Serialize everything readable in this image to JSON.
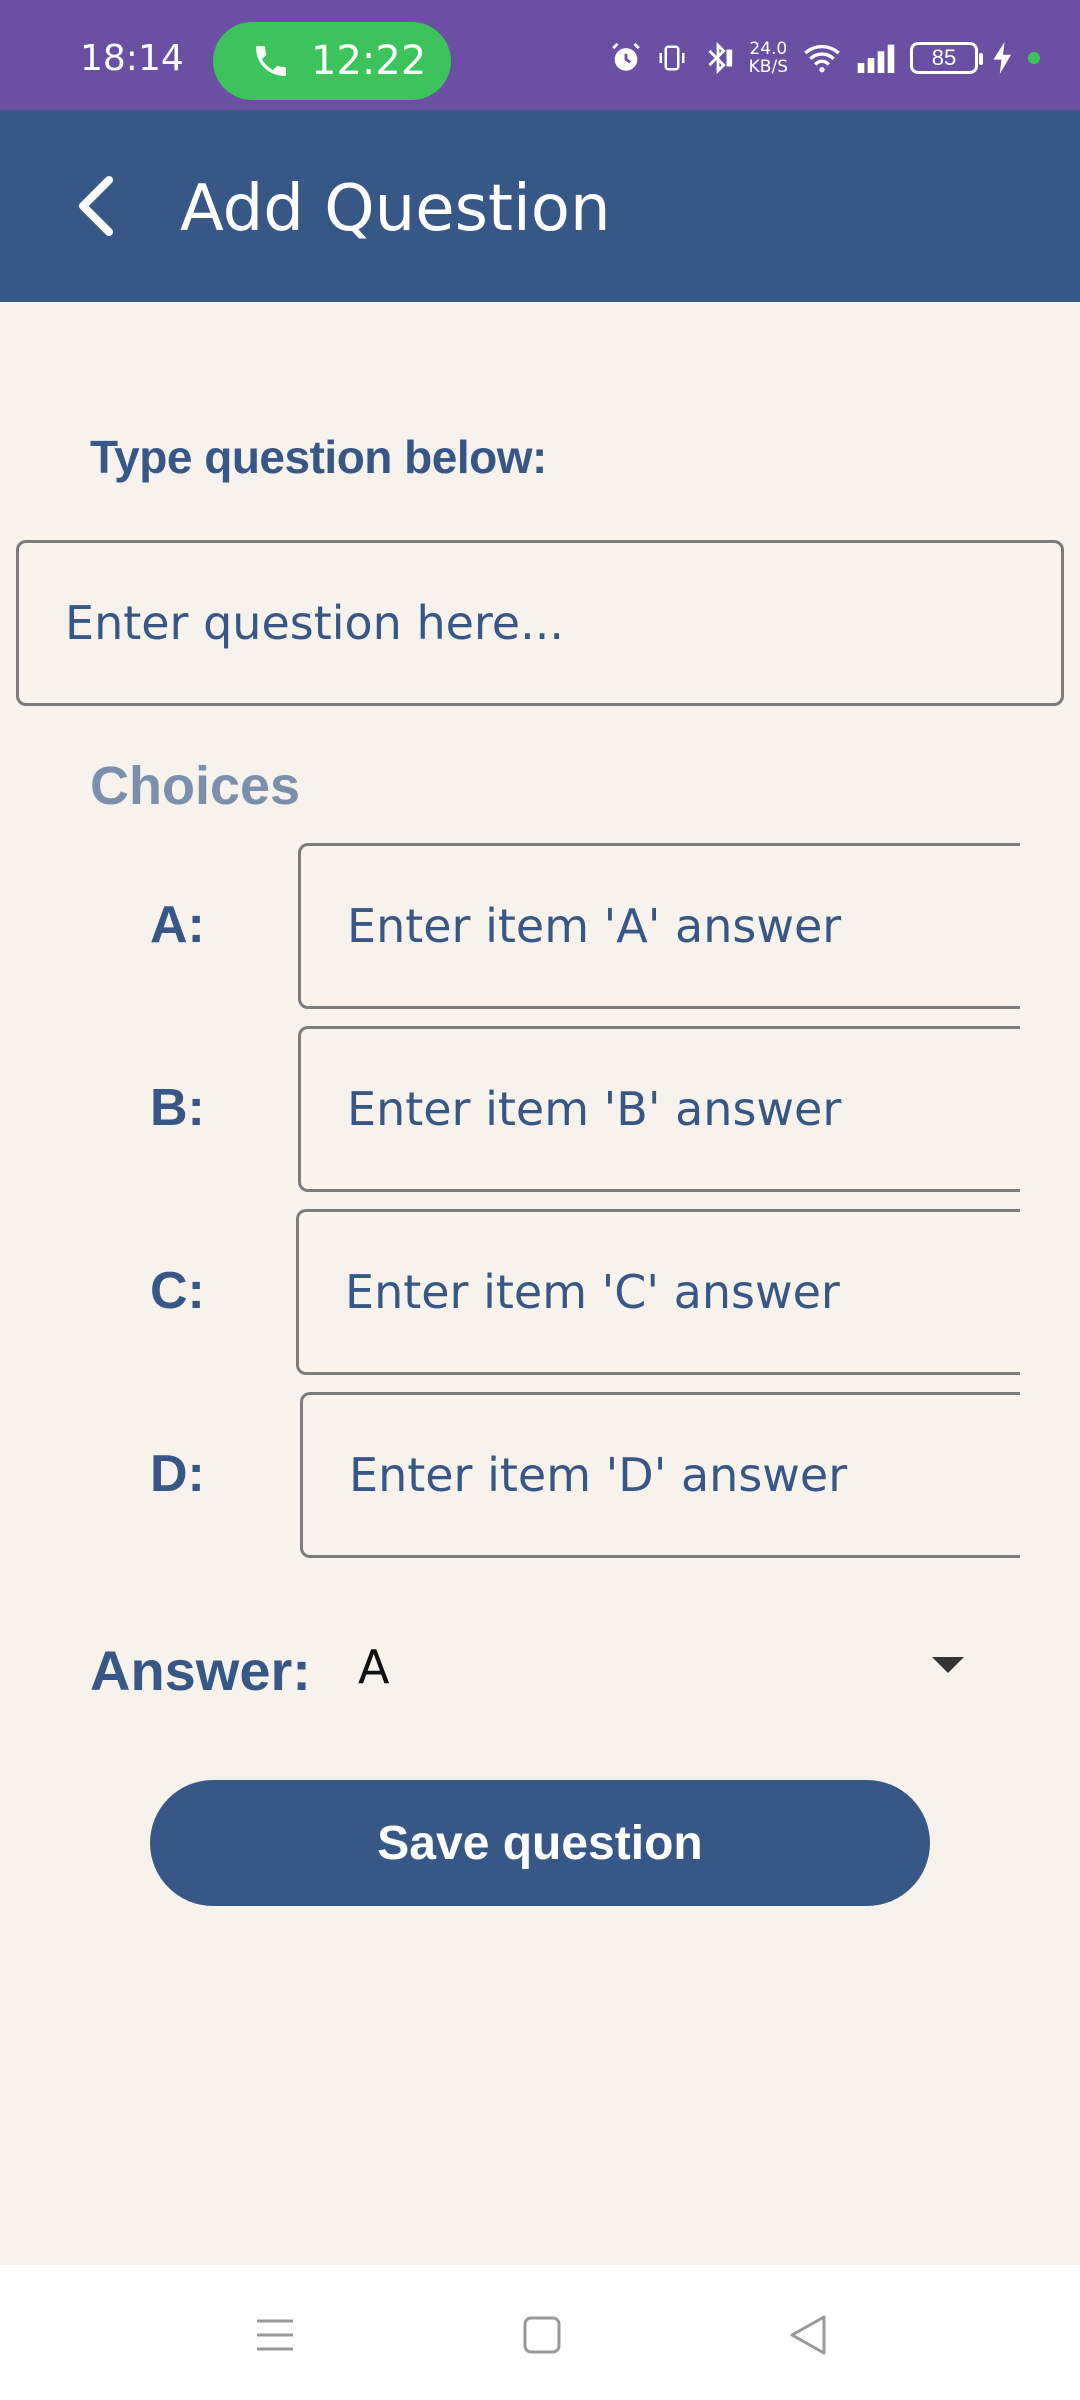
{
  "status_bar": {
    "time": "18:14",
    "call_time": "12:22",
    "net_speed_value": "24.0",
    "net_speed_unit": "KB/S",
    "battery": "85"
  },
  "app_bar": {
    "title": "Add Question"
  },
  "form": {
    "question_label": "Type question below:",
    "question_placeholder": "Enter question here...",
    "choices_heading": "Choices",
    "choices": [
      {
        "letter": "A:",
        "placeholder": "Enter item 'A' answer"
      },
      {
        "letter": "B:",
        "placeholder": "Enter item 'B' answer"
      },
      {
        "letter": "C:",
        "placeholder": "Enter item 'C' answer"
      },
      {
        "letter": "D:",
        "placeholder": "Enter item 'D' answer"
      }
    ],
    "answer_label": "Answer:",
    "answer_value": "A",
    "save_label": "Save question"
  },
  "colors": {
    "status_bar": "#6a4fa3",
    "app_bar": "#375786",
    "background": "#f7f2ec",
    "call_pill": "#3dc35b"
  },
  "icons": {
    "back": "chevron-left-icon",
    "call": "phone-icon",
    "menu": "menu-icon",
    "home": "home-square-icon",
    "nav_back": "triangle-back-icon"
  }
}
